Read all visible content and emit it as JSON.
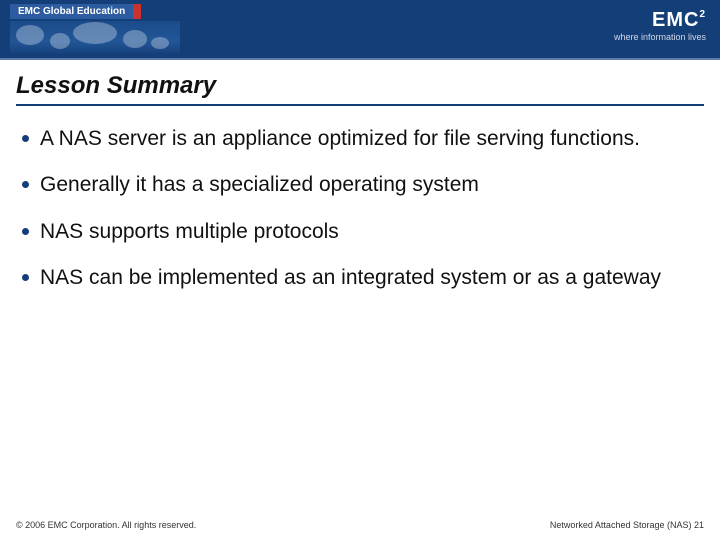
{
  "header": {
    "brand": "EMC Global Education",
    "logo_text": "EMC",
    "logo_sup": "2",
    "tagline": "where information lives"
  },
  "title": "Lesson Summary",
  "bullets": [
    "A NAS server is an appliance optimized for file serving functions.",
    "Generally it has a specialized operating system",
    "NAS supports multiple protocols",
    "NAS can be implemented as an integrated system or as a gateway"
  ],
  "footer": {
    "left": "© 2006 EMC Corporation. All rights reserved.",
    "right": "Networked Attached Storage (NAS) 21"
  }
}
